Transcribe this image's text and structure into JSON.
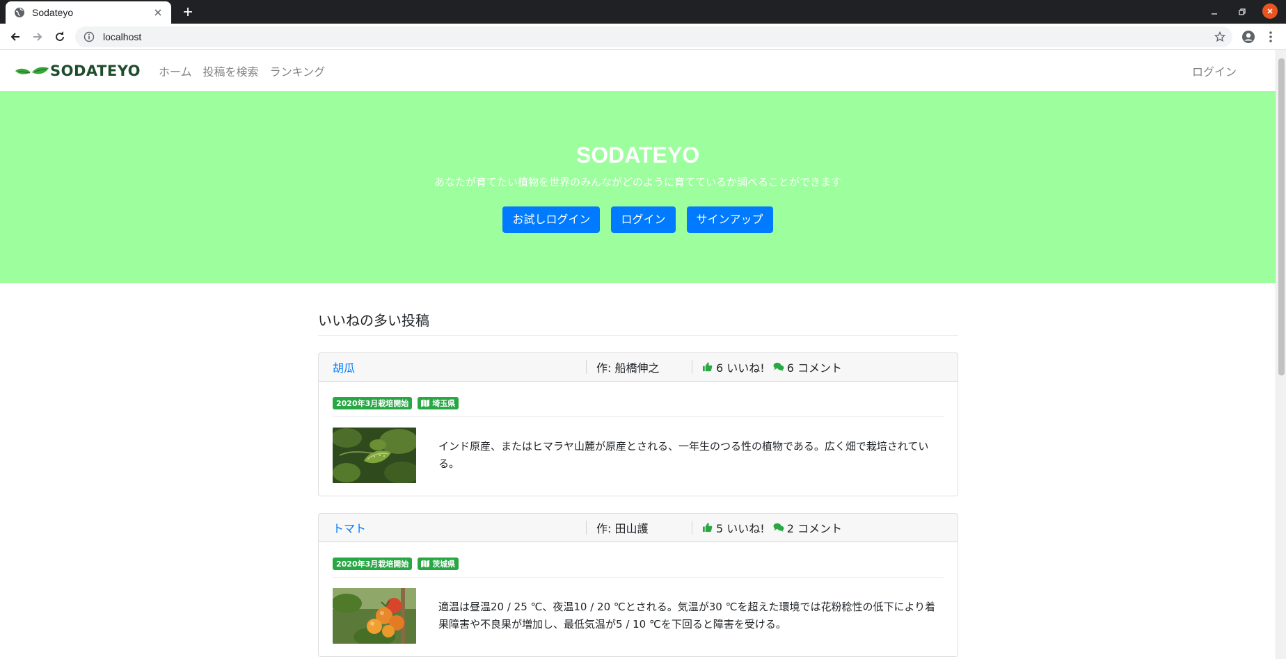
{
  "browser": {
    "tab_title": "Sodateyo",
    "url": "localhost",
    "icons": [
      "globe-icon",
      "close-icon",
      "plus-icon",
      "back-icon",
      "forward-icon",
      "reload-icon",
      "info-icon",
      "star-icon",
      "account-icon",
      "menu-icon",
      "minimize-icon",
      "restore-icon"
    ]
  },
  "nav": {
    "brand": "SODATEYO",
    "links": [
      "ホーム",
      "投稿を検索",
      "ランキング"
    ],
    "login": "ログイン"
  },
  "hero": {
    "title": "SODATEYO",
    "subtitle": "あなたが育てたい植物を世界のみんながどのように育てているか調べることができます",
    "buttons": [
      "お試しログイン",
      "ログイン",
      "サインアップ"
    ],
    "background_color": "#9cfe9c",
    "button_color": "#007bff"
  },
  "section": {
    "title": "いいねの多い投稿"
  },
  "posts": [
    {
      "title": "胡瓜",
      "author": "作: 船橋伸之",
      "likes": "6 いいね!",
      "comments": "6 コメント",
      "start_badge": "2020年3月栽培開始",
      "region_badge": "埼玉県",
      "text": "インド原産、またはヒマラヤ山麓が原産とされる、一年生のつる性の植物である。広く畑で栽培されている。",
      "image": "cucumber-photo"
    },
    {
      "title": "トマト",
      "author": "作: 田山護",
      "likes": "5 いいね!",
      "comments": "2 コメント",
      "start_badge": "2020年3月栽培開始",
      "region_badge": "茨城県",
      "text": "適温は昼温20 / 25 ℃、夜温10 / 20 ℃とされる。気温が30 ℃を超えた環境では花粉稔性の低下により着果障害や不良果が増加し、最低気温が5 / 10 ℃を下回ると障害を受ける。",
      "image": "tomato-photo"
    }
  ]
}
